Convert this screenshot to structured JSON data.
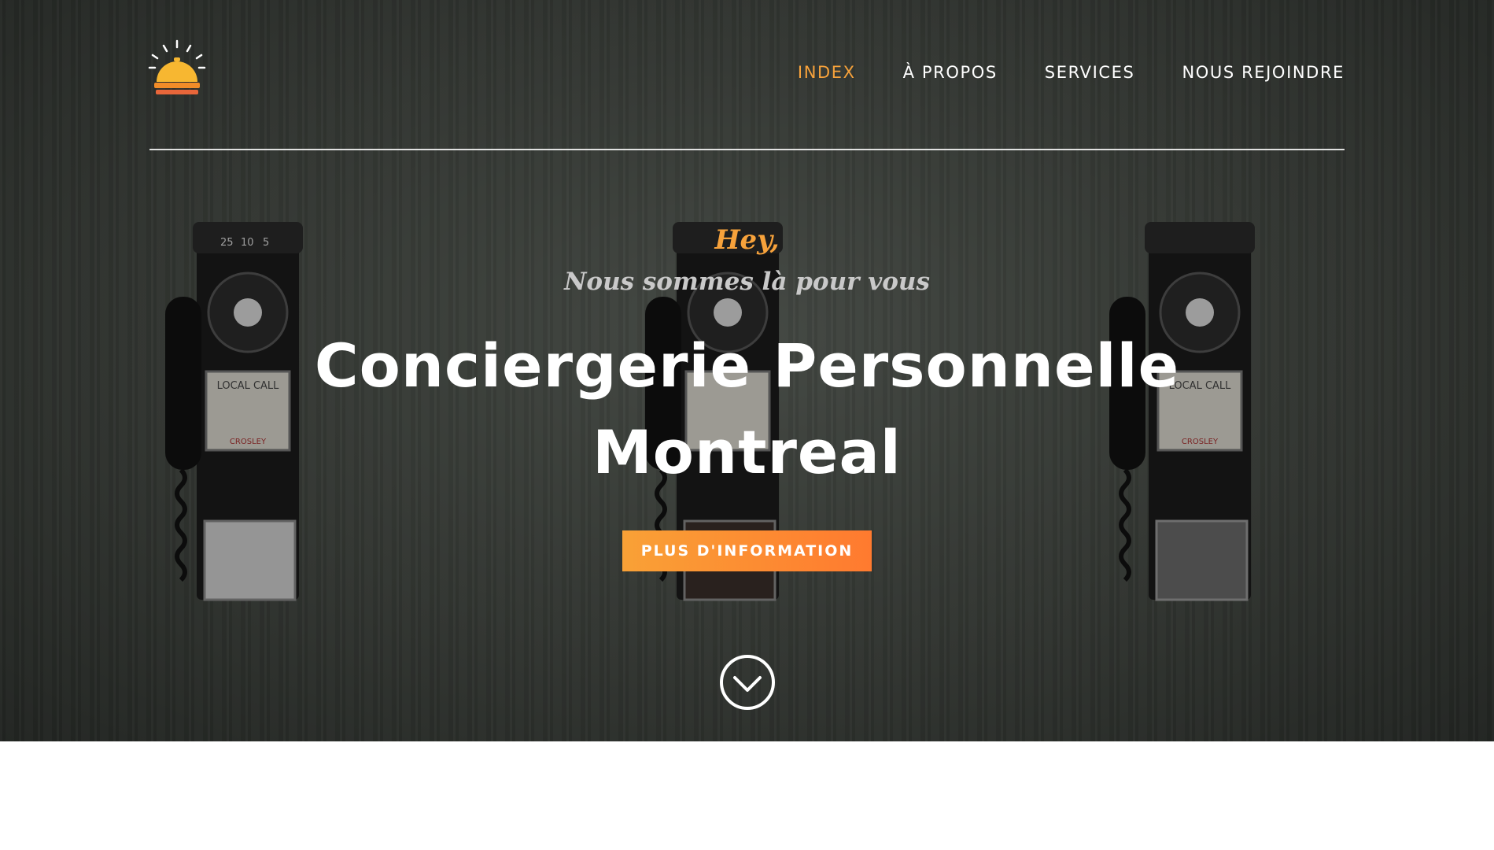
{
  "brand": {
    "logo_icon": "service-bell-icon",
    "colors": {
      "accent": "#f7a23b",
      "button_start": "#f9a136",
      "button_end": "#ff7a2f",
      "text": "#ffffff"
    }
  },
  "nav": {
    "items": [
      {
        "label": "INDEX",
        "active": true
      },
      {
        "label": "À PROPOS",
        "active": false
      },
      {
        "label": "SERVICES",
        "active": false
      },
      {
        "label": "NOUS REJOINDRE",
        "active": false
      }
    ]
  },
  "hero": {
    "greeting": "Hey,",
    "tagline": "Nous sommes là pour vous",
    "title_line1": "Conciergerie Personnelle",
    "title_line2": "Montreal",
    "cta_label": "PLUS D'INFORMATION",
    "scroll_icon": "chevron-down-circle-icon",
    "phone_labels": {
      "local_call": "LOCAL CALL",
      "brand": "CROSLEY",
      "coins": [
        "25",
        "10",
        "5"
      ]
    }
  }
}
